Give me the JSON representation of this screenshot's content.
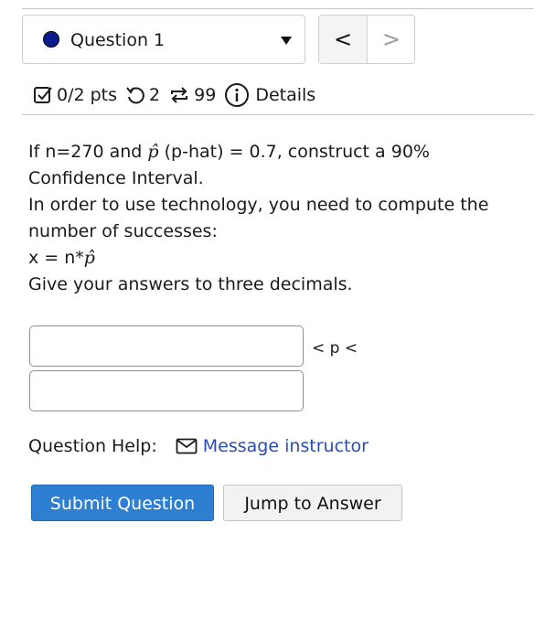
{
  "question_nav": {
    "selected_question": "Question 1",
    "prev_symbol": "<",
    "next_symbol": ">",
    "status_color": "#0b1a8c"
  },
  "status": {
    "score": "0/2 pts",
    "retries": "2",
    "attempts": "99",
    "details_label": "Details",
    "icons": [
      "checkbox-icon",
      "retry-icon",
      "repeat-icon",
      "info-icon"
    ]
  },
  "question": {
    "line1_before": "If n=270 and",
    "line1_phat": "p̂",
    "line1_after": "(p-hat) = 0.7, construct a 90%",
    "line2": "Confidence Interval.",
    "line3": "In order to use technology, you need to compute the",
    "line4": "number of successes:",
    "line5_before": "x = n*",
    "line5_phat": "p̂",
    "line6": "Give your answers to three decimals."
  },
  "answers": {
    "lower_value": "",
    "upper_value": "",
    "between_label": "< p <"
  },
  "help": {
    "label": "Question Help:",
    "message_link": "Message instructor"
  },
  "buttons": {
    "submit": "Submit Question",
    "jump": "Jump to Answer"
  },
  "colors": {
    "accent": "#2e7fd1",
    "link": "#2a4cb3"
  }
}
